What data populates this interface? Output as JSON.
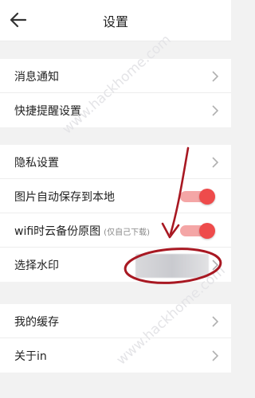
{
  "header": {
    "title": "设置",
    "back_icon": "arrow-left-icon"
  },
  "groups": [
    {
      "items": [
        {
          "label": "消息通知",
          "control": "chevron"
        },
        {
          "label": "快捷提醒设置",
          "control": "chevron"
        }
      ]
    },
    {
      "items": [
        {
          "label": "隐私设置",
          "control": "chevron"
        },
        {
          "label": "图片自动保存到本地",
          "control": "toggle",
          "on": true
        },
        {
          "label": "wifi时云备份原图",
          "sub": "(仅自己下载)",
          "control": "toggle",
          "on": true
        },
        {
          "label": "选择水印",
          "control": "chevron"
        }
      ]
    },
    {
      "items": [
        {
          "label": "我的缓存",
          "control": "chevron"
        },
        {
          "label": "关于in",
          "control": "chevron"
        }
      ]
    }
  ],
  "colors": {
    "accent": "#ee4b4b",
    "annotation": "#a81822",
    "watermark": "#e7e7ea"
  },
  "watermark_text": "www.hackhome.com"
}
